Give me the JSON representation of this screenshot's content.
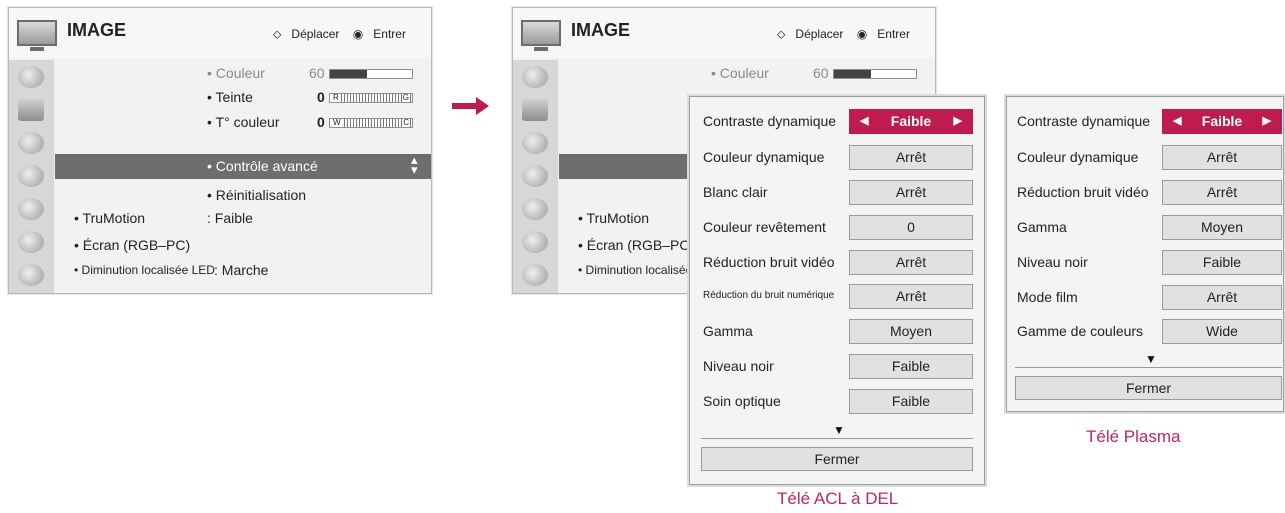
{
  "menu": {
    "title": "IMAGE",
    "hint_move": "Déplacer",
    "hint_enter": "Entrer",
    "icons": [
      "image-icon",
      "tv-icon",
      "speaker-icon",
      "clock-icon",
      "lock-icon",
      "input-icon",
      "globe-icon"
    ],
    "couleur_label": "• Couleur",
    "couleur_value": "60",
    "couleur_level": 0.45,
    "teinte_label": "• Teinte",
    "teinte_value": "0",
    "teinte_left": "R",
    "teinte_right": "G",
    "tcouleur_label": "• T° couleur",
    "tcouleur_value": "0",
    "tcouleur_left": "W",
    "tcouleur_right": "C",
    "controle_label": "• Contrôle avancé",
    "reinit_label": "• Réinitialisation",
    "trumotion_label": "• TruMotion",
    "trumotion_value": ": Faible",
    "ecran_label": "• Écran (RGB–PC)",
    "diminution_label": "• Diminution localisée LED",
    "diminution_value": ": Marche"
  },
  "popup_acl": {
    "rows": [
      {
        "label": "Contraste dynamique",
        "value": "Faible"
      },
      {
        "label": "Couleur dynamique",
        "value": "Arrêt"
      },
      {
        "label": "Blanc clair",
        "value": "Arrêt"
      },
      {
        "label": "Couleur revêtement",
        "value": "0"
      },
      {
        "label": "Réduction bruit vidéo",
        "value": "Arrêt"
      },
      {
        "label": "Réduction du bruit numérique",
        "value": "Arrêt"
      },
      {
        "label": "Gamma",
        "value": "Moyen"
      },
      {
        "label": "Niveau noir",
        "value": "Faible"
      },
      {
        "label": "Soin optique",
        "value": "Faible"
      }
    ],
    "more": "▼",
    "close": "Fermer",
    "caption": "Télé ACL à DEL"
  },
  "popup_plasma": {
    "rows": [
      {
        "label": "Contraste dynamique",
        "value": "Faible"
      },
      {
        "label": "Couleur dynamique",
        "value": "Arrêt"
      },
      {
        "label": "Réduction bruit vidéo",
        "value": "Arrêt"
      },
      {
        "label": "Gamma",
        "value": "Moyen"
      },
      {
        "label": "Niveau noir",
        "value": "Faible"
      },
      {
        "label": "Mode film",
        "value": "Arrêt"
      },
      {
        "label": "Gamme de couleurs",
        "value": "Wide"
      }
    ],
    "more": "▼",
    "close": "Fermer",
    "caption": "Télé Plasma"
  },
  "colors": {
    "accent": "#c01b4e",
    "highlight": "#6e6e6e",
    "caption": "#c0285a"
  }
}
